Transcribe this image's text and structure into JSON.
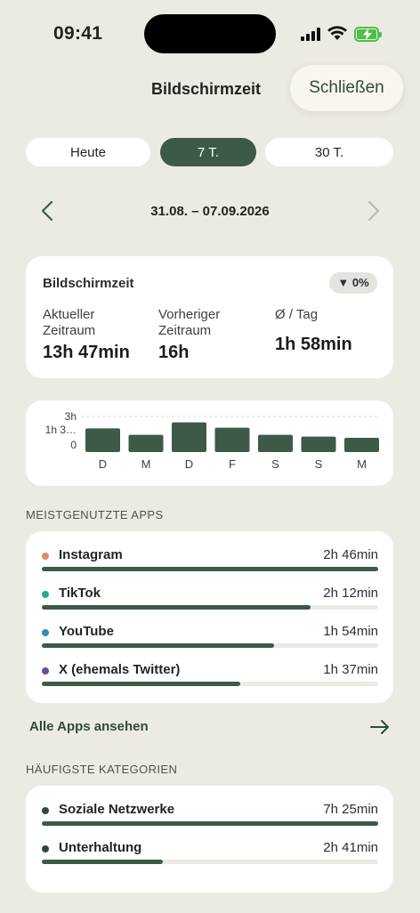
{
  "status_bar": {
    "time": "09:41"
  },
  "header": {
    "title": "Bildschirmzeit",
    "close_label": "Schließen"
  },
  "tabs": [
    {
      "label": "Heute",
      "active": false
    },
    {
      "label": "7 T.",
      "active": true
    },
    {
      "label": "30 T.",
      "active": false
    }
  ],
  "date_range": "31.08. – 07.09.2026",
  "summary": {
    "title": "Bildschirmzeit",
    "change_badge": "▼ 0%",
    "current_label_1": "Aktueller",
    "current_label_2": "Zeitraum",
    "current_value": "13h 47min",
    "previous_label_1": "Vorheriger",
    "previous_label_2": "Zeitraum",
    "previous_value": "16h",
    "avg_label": "Ø / Tag",
    "avg_value": "1h 58min"
  },
  "chart_data": {
    "type": "bar",
    "categories": [
      "D",
      "M",
      "D",
      "F",
      "S",
      "S",
      "M"
    ],
    "values": [
      2.0,
      1.45,
      2.5,
      2.05,
      1.45,
      1.3,
      1.2
    ],
    "y_tick_labels": [
      "3h",
      "1h 3…",
      "0"
    ],
    "ylim": [
      0,
      3
    ],
    "colors": {
      "bar": "#3d5a48"
    }
  },
  "most_used": {
    "heading": "MEISTGENUTZTE APPS",
    "items": [
      {
        "name": "Instagram",
        "time": "2h 46min",
        "fraction": 1.0,
        "color": "#e0896b"
      },
      {
        "name": "TikTok",
        "time": "2h 12min",
        "fraction": 0.8,
        "color": "#2aa88a"
      },
      {
        "name": "YouTube",
        "time": "1h 54min",
        "fraction": 0.69,
        "color": "#2e8fb0"
      },
      {
        "name": "X (ehemals Twitter)",
        "time": "1h 37min",
        "fraction": 0.59,
        "color": "#6a4c93"
      }
    ],
    "all_apps_label": "Alle Apps ansehen"
  },
  "categories": {
    "heading": "HÄUFIGSTE KATEGORIEN",
    "items": [
      {
        "name": "Soziale Netzwerke",
        "time": "7h 25min",
        "fraction": 1.0,
        "color": "#2f4a3c"
      },
      {
        "name": "Unterhaltung",
        "time": "2h 41min",
        "fraction": 0.36,
        "color": "#2f4a3c"
      }
    ]
  },
  "colors": {
    "accent": "#3d5a48",
    "background": "#ecebe3",
    "card": "#ffffff"
  }
}
